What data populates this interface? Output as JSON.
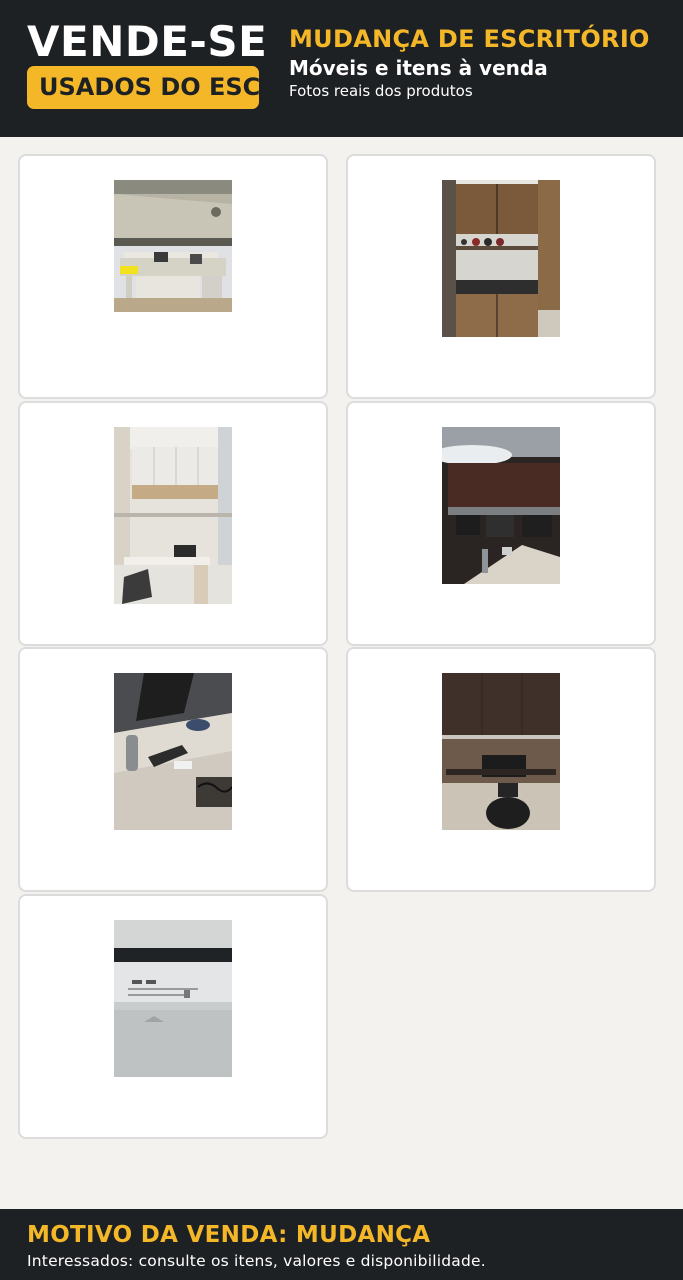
{
  "header": {
    "headline": "VENDE-SE",
    "badge": "USADOS DO ESCR",
    "title": "MUDANÇA DE ESCRITÓRIO",
    "subtitle": "Móveis e itens à venda",
    "note": "Fotos reais dos produtos"
  },
  "colors": {
    "dark": "#1e2124",
    "accent": "#f4b728",
    "background": "#f3f2ef",
    "card": "#ffffff"
  },
  "products": [
    {
      "photo": "desk-photo"
    },
    {
      "photo": "wall-cabinet-photo"
    },
    {
      "photo": "white-cabinet-desk-photo"
    },
    {
      "photo": "workstations-photo"
    },
    {
      "photo": "desk-closeup-photo"
    },
    {
      "photo": "dark-cabinet-desk-photo"
    },
    {
      "photo": "label-closeup-photo"
    }
  ],
  "footer": {
    "title": "MOTIVO DA VENDA: MUDANÇA",
    "text": "Interessados: consulte os itens, valores e disponibilidade."
  }
}
